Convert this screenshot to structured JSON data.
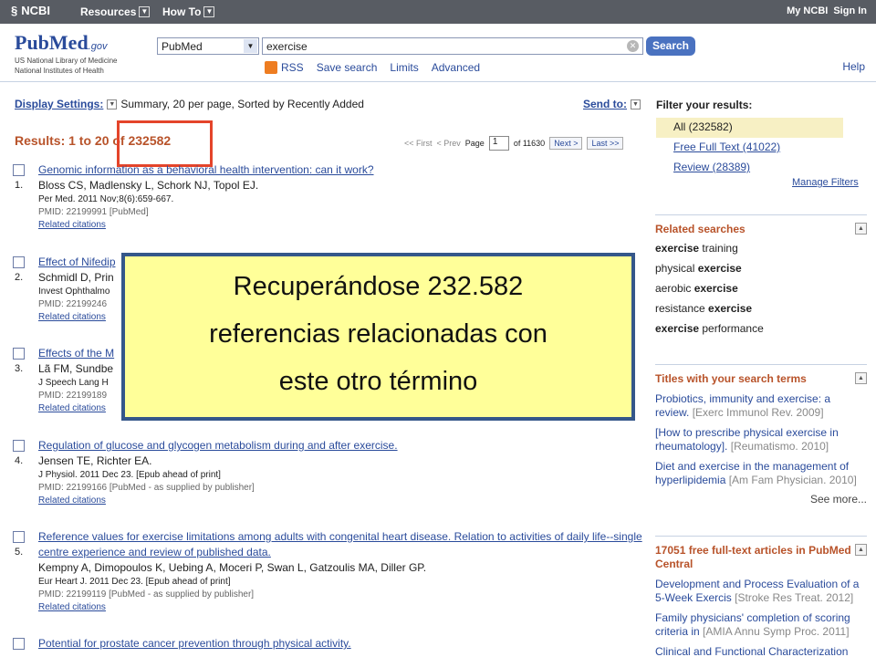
{
  "topbar": {
    "logo": "NCBI",
    "resources": "Resources",
    "howto": "How To",
    "my_ncbi": "My NCBI",
    "sign_in": "Sign In"
  },
  "header": {
    "logo_main": "PubMed",
    "logo_suffix": ".gov",
    "logo_sub1": "US National Library of Medicine",
    "logo_sub2": "National Institutes of Health",
    "database": "PubMed",
    "query": "exercise",
    "search_label": "Search",
    "subnav": [
      "RSS",
      "Save search",
      "Limits",
      "Advanced"
    ],
    "help": "Help"
  },
  "display": {
    "label": "Display Settings:",
    "value": "Summary, 20 per page, Sorted by Recently Added",
    "send_to": "Send to:"
  },
  "results": {
    "count_label": "Results: 1 to 20 of 232582",
    "first": "<< First",
    "prev": "< Prev",
    "page_label": "Page",
    "page": "1",
    "of_pages": "of 11630",
    "next": "Next >",
    "last": "Last >>"
  },
  "items": [
    {
      "num": "1.",
      "title": "Genomic information as a behavioral health intervention: can it work?",
      "authors": "Bloss CS, Madlensky L, Schork NJ, Topol EJ.",
      "journal": "Per Med. 2011 Nov;8(6):659-667.",
      "pmid": "PMID: 22199991 [PubMed]",
      "related": "Related citations"
    },
    {
      "num": "2.",
      "title": "Effect of Nifedip",
      "authors": "Schmidl D, Prin",
      "journal": "Invest Ophthalmo",
      "pmid": "PMID: 22199246",
      "related": "Related citations"
    },
    {
      "num": "3.",
      "title": "Effects of the M",
      "authors": "Lã FM, Sundbe",
      "journal": "J Speech Lang H",
      "pmid": "PMID: 22199189",
      "related": "Related citations"
    },
    {
      "num": "4.",
      "title": "Regulation of glucose and glycogen metabolism during and after exercise.",
      "authors": "Jensen TE, Richter EA.",
      "journal": "J Physiol. 2011 Dec 23. [Epub ahead of print]",
      "pmid": "PMID: 22199166 [PubMed - as supplied by publisher]",
      "related": "Related citations"
    },
    {
      "num": "5.",
      "title": "Reference values for exercise limitations among adults with congenital heart disease. Relation to activities of daily life--single centre experience and review of published data.",
      "authors": "Kempny A, Dimopoulos K, Uebing A, Moceri P, Swan L, Gatzoulis MA, Diller GP.",
      "journal": "Eur Heart J. 2011 Dec 23. [Epub ahead of print]",
      "pmid": "PMID: 22199119 [PubMed - as supplied by publisher]",
      "related": "Related citations"
    },
    {
      "num": "6.",
      "title": "Potential for prostate cancer prevention through physical activity.",
      "authors": "",
      "journal": "",
      "pmid": "",
      "related": ""
    }
  ],
  "filter": {
    "heading": "Filter your results:",
    "all": "All (232582)",
    "free": "Free Full Text (41022)",
    "review": "Review (28389)",
    "manage": "Manage Filters"
  },
  "related_searches": {
    "heading": "Related searches",
    "items": [
      {
        "pre": "",
        "bold": "exercise",
        "post": " training"
      },
      {
        "pre": "physical ",
        "bold": "exercise",
        "post": ""
      },
      {
        "pre": "aerobic ",
        "bold": "exercise",
        "post": ""
      },
      {
        "pre": "resistance ",
        "bold": "exercise",
        "post": ""
      },
      {
        "pre": "",
        "bold": "exercise",
        "post": " performance"
      }
    ]
  },
  "titles_panel": {
    "heading": "Titles with your search terms",
    "items": [
      {
        "text": "Probiotics, immunity and exercise: a review.",
        "cite": "[Exerc Immunol Rev. 2009]"
      },
      {
        "text": "[How to prescribe physical exercise in rheumatology].",
        "cite": "[Reumatismo. 2010]"
      },
      {
        "text": "Diet and exercise in the management of hyperlipidemia",
        "cite": "[Am Fam Physician. 2010]"
      }
    ],
    "more": "See more..."
  },
  "pmc_panel": {
    "heading": "17051 free full-text articles in PubMed Central",
    "items": [
      {
        "text": "Development and Process Evaluation of a 5-Week Exercis",
        "cite": "[Stroke Res Treat. 2012]"
      },
      {
        "text": "Family physicians' completion of scoring criteria in",
        "cite": "[AMIA Annu Symp Proc. 2011]"
      },
      {
        "text": "Clinical and Functional Characterization",
        "cite": ""
      }
    ]
  },
  "overlay": {
    "line1": "Recuperándose 232.582",
    "line2": "referencias relacionadas con",
    "line3": "este otro término"
  },
  "colors": {
    "topbar": "#585c63",
    "link": "#2a4b9b",
    "results_heading": "#b8532a",
    "highlight_box": "#e4442a",
    "overlay_bg": "#ffff99",
    "overlay_border": "#35578a"
  }
}
